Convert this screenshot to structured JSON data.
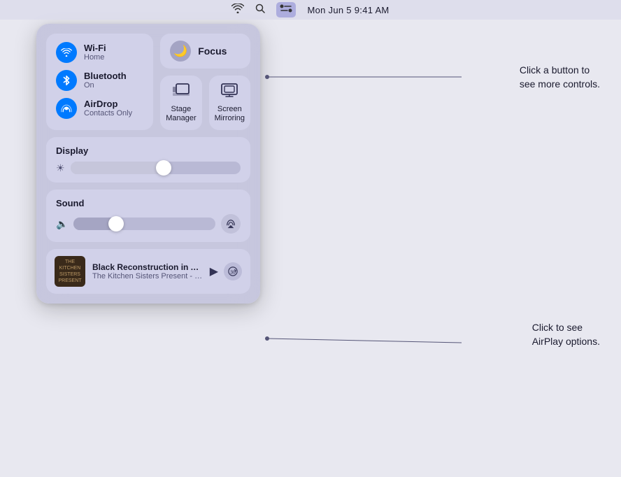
{
  "menubar": {
    "time": "Mon Jun 5  9:41 AM",
    "icons": [
      "wifi",
      "search",
      "controlcenter"
    ]
  },
  "connectivity": {
    "wifi": {
      "label": "Wi-Fi",
      "sublabel": "Home"
    },
    "bluetooth": {
      "label": "Bluetooth",
      "sublabel": "On"
    },
    "airdrop": {
      "label": "AirDrop",
      "sublabel": "Contacts Only"
    }
  },
  "focus": {
    "label": "Focus"
  },
  "stage_manager": {
    "label": "Stage\nManager"
  },
  "screen_mirroring": {
    "label": "Screen\nMirroring"
  },
  "display": {
    "title": "Display",
    "brightness": 55
  },
  "sound": {
    "title": "Sound",
    "volume": 30
  },
  "now_playing": {
    "title": "Black Reconstruction in America...",
    "artist": "The Kitchen Sisters Present - March 7, 2..."
  },
  "callouts": {
    "button_callout": "Click a button to\nsee more controls.",
    "airplay_callout": "Click to see\nAirPlay options."
  },
  "album_art_text": "THE\nKITCHEN\nSISTERS\nPRESENT"
}
